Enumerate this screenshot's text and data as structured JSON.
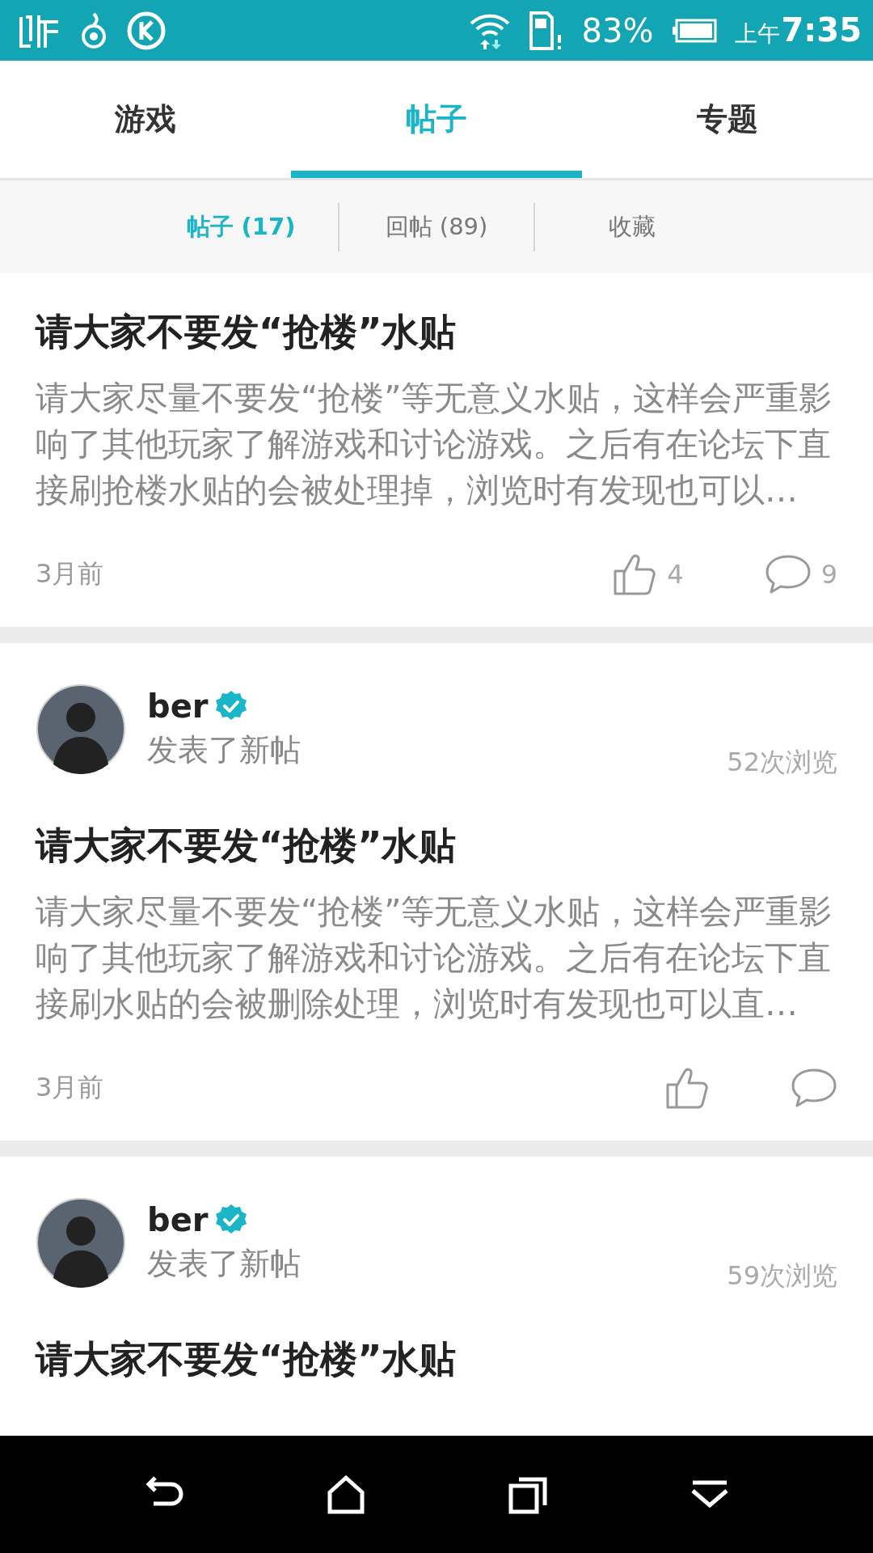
{
  "status_bar": {
    "battery": "83%",
    "time_prefix": "上午",
    "time": "7:35"
  },
  "tabs": [
    {
      "label": "游戏",
      "selected": false
    },
    {
      "label": "帖子",
      "selected": true
    },
    {
      "label": "专题",
      "selected": false
    }
  ],
  "sub_tabs": [
    {
      "label": "帖子 (17)",
      "selected": true
    },
    {
      "label": "回帖 (89)",
      "selected": false
    },
    {
      "label": "收藏",
      "selected": false
    }
  ],
  "posts": [
    {
      "title": "请大家不要发“抢楼”水贴",
      "body": "请大家尽量不要发“抢楼”等无意义水贴，这样会严重影响了其他玩家了解游戏和讨论游戏。之后有在论坛下直接刷抢楼水贴的会被处理掉，浏览时有发现也可以…",
      "time": "3月前",
      "likes": "4",
      "comments": "9"
    },
    {
      "author": {
        "name": "ber",
        "verified": true
      },
      "action": "发表了新帖",
      "views": "52次浏览",
      "title": "请大家不要发“抢楼”水贴",
      "body": "请大家尽量不要发“抢楼”等无意义水贴，这样会严重影响了其他玩家了解游戏和讨论游戏。之后有在论坛下直接刷水贴的会被删除处理，浏览时有发现也可以直…",
      "time": "3月前"
    },
    {
      "author": {
        "name": "ber",
        "verified": true
      },
      "action": "发表了新帖",
      "views": "59次浏览",
      "title": "请大家不要发“抢楼”水贴"
    }
  ]
}
